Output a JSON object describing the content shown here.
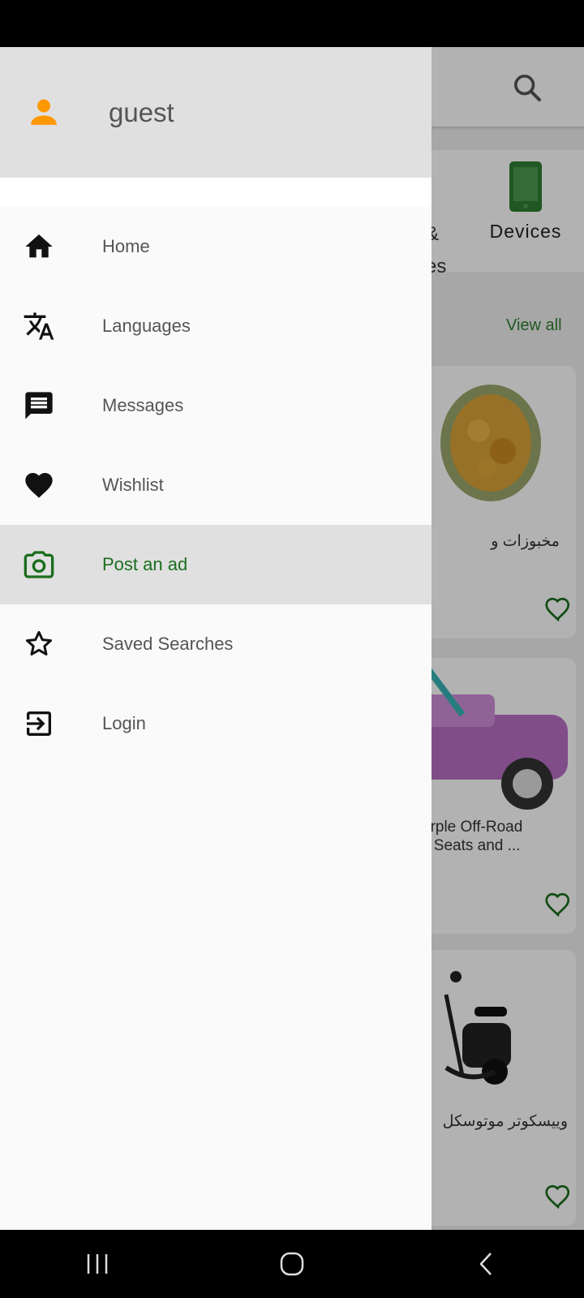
{
  "drawer": {
    "username": "guest",
    "items": [
      {
        "label": "Home",
        "icon": "home-icon"
      },
      {
        "label": "Languages",
        "icon": "translate-icon"
      },
      {
        "label": "Messages",
        "icon": "message-icon"
      },
      {
        "label": "Wishlist",
        "icon": "heart-icon"
      },
      {
        "label": "Post an ad",
        "icon": "camera-icon",
        "active": true
      },
      {
        "label": "Saved Searches",
        "icon": "star-icon"
      },
      {
        "label": "Login",
        "icon": "login-icon"
      }
    ]
  },
  "background": {
    "category_partial_1": "&",
    "category_partial_2": "es",
    "devices_label": "Devices",
    "view_all": "View all",
    "cards": [
      {
        "title": "مخبوزات و"
      },
      {
        "title_line1": "urple Off-Road",
        "title_line2": "k Seats and ..."
      },
      {
        "title": "وييسكوتر موتوسكل"
      }
    ]
  },
  "colors": {
    "accent_green": "#1b6e1e",
    "user_icon": "#ff9800",
    "header_bg": "#e0e0e0"
  }
}
